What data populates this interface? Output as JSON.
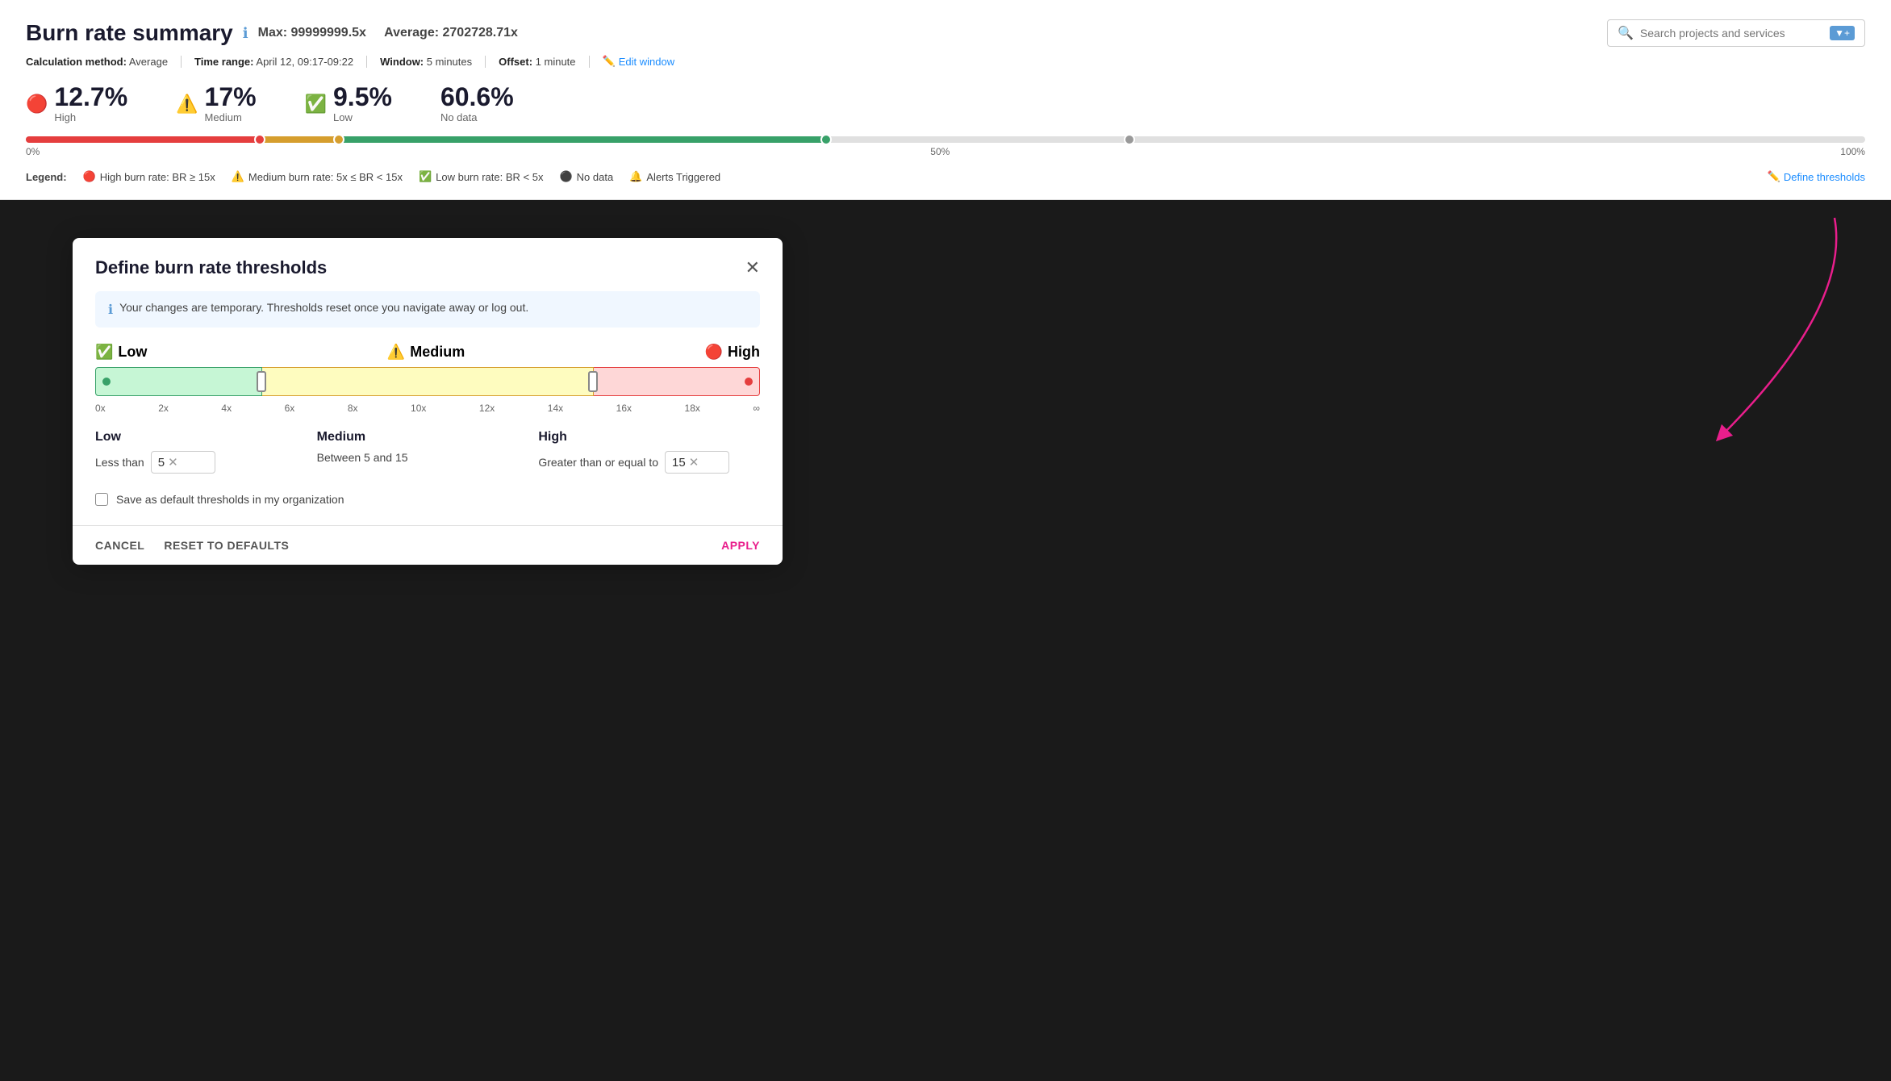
{
  "header": {
    "title": "Burn rate summary",
    "max": "Max: 99999999.5x",
    "average": "Average: 2702728.71x",
    "search_placeholder": "Search projects and services"
  },
  "meta": {
    "calculation_label": "Calculation method:",
    "calculation_value": "Average",
    "time_range_label": "Time range:",
    "time_range_value": "April 12, 09:17-09:22",
    "window_label": "Window:",
    "window_value": "5 minutes",
    "offset_label": "Offset:",
    "offset_value": "1 minute",
    "edit_window": "Edit window"
  },
  "stats": [
    {
      "value": "12.7%",
      "label": "High",
      "icon_type": "red-error"
    },
    {
      "value": "17%",
      "label": "Medium",
      "icon_type": "yellow-warning"
    },
    {
      "value": "9.5%",
      "label": "Low",
      "icon_type": "green-check"
    },
    {
      "value": "60.6%",
      "label": "No data",
      "icon_type": "none"
    }
  ],
  "progress": {
    "labels": [
      "0%",
      "50%",
      "100%"
    ]
  },
  "legend": {
    "label": "Legend:",
    "items": [
      {
        "text": "High burn rate: BR ≥ 15x",
        "icon_type": "red-error"
      },
      {
        "text": "Medium burn rate: 5x ≤ BR < 15x",
        "icon_type": "yellow-warning"
      },
      {
        "text": "Low burn rate: BR < 5x",
        "icon_type": "green-check"
      },
      {
        "text": "No data",
        "icon_type": "gray-dot"
      },
      {
        "text": "Alerts Triggered",
        "icon_type": "bell-red"
      }
    ],
    "define_thresholds": "Define thresholds"
  },
  "modal": {
    "title": "Define burn rate thresholds",
    "info_text": "Your changes are temporary. Thresholds reset once you navigate away or log out.",
    "categories": [
      {
        "label": "Low",
        "icon_type": "green-check"
      },
      {
        "label": "Medium",
        "icon_type": "yellow-warning"
      },
      {
        "label": "High",
        "icon_type": "red-error"
      }
    ],
    "axis_labels": [
      "0x",
      "2x",
      "4x",
      "6x",
      "8x",
      "10x",
      "12x",
      "14x",
      "16x",
      "18x",
      "∞"
    ],
    "inputs": [
      {
        "title": "Low",
        "desc": "Less than",
        "value": "5",
        "type": "input"
      },
      {
        "title": "Medium",
        "desc": "Between 5 and 15",
        "type": "text"
      },
      {
        "title": "High",
        "desc": "Greater than or equal to",
        "value": "15",
        "type": "input"
      }
    ],
    "checkbox_label": "Save as default thresholds in my organization",
    "cancel_btn": "CANCEL",
    "reset_btn": "RESET TO DEFAULTS",
    "apply_btn": "APPLY"
  }
}
